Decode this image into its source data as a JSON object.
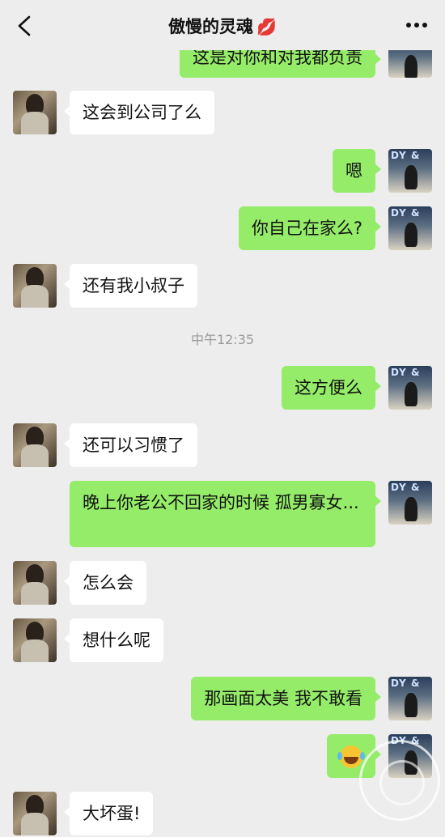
{
  "header": {
    "title": "傲慢的灵魂",
    "title_emoji": "💋"
  },
  "messages": [
    {
      "side": "out",
      "text": "这是对你和对我都负责"
    },
    {
      "side": "in",
      "text": "这会到公司了么"
    },
    {
      "side": "out",
      "text": "嗯"
    },
    {
      "side": "out",
      "text": "你自己在家么?"
    },
    {
      "side": "in",
      "text": "还有我小叔子"
    },
    {
      "side": "time",
      "text": "中午12:35"
    },
    {
      "side": "out",
      "text": "这方便么"
    },
    {
      "side": "in",
      "text": "还可以习惯了"
    },
    {
      "side": "out",
      "text": "晚上你老公不回家的时候  孤男寡女..."
    },
    {
      "side": "in",
      "text": "怎么会"
    },
    {
      "side": "in",
      "text": "想什么呢"
    },
    {
      "side": "out",
      "text": "那画面太美  我不敢看"
    },
    {
      "side": "out",
      "text": "",
      "emoji": "face-with-tears-of-joy"
    },
    {
      "side": "in",
      "text": "大坏蛋!"
    }
  ],
  "colors": {
    "background": "#ededed",
    "incoming_bubble": "#ffffff",
    "outgoing_bubble": "#95ec69"
  }
}
